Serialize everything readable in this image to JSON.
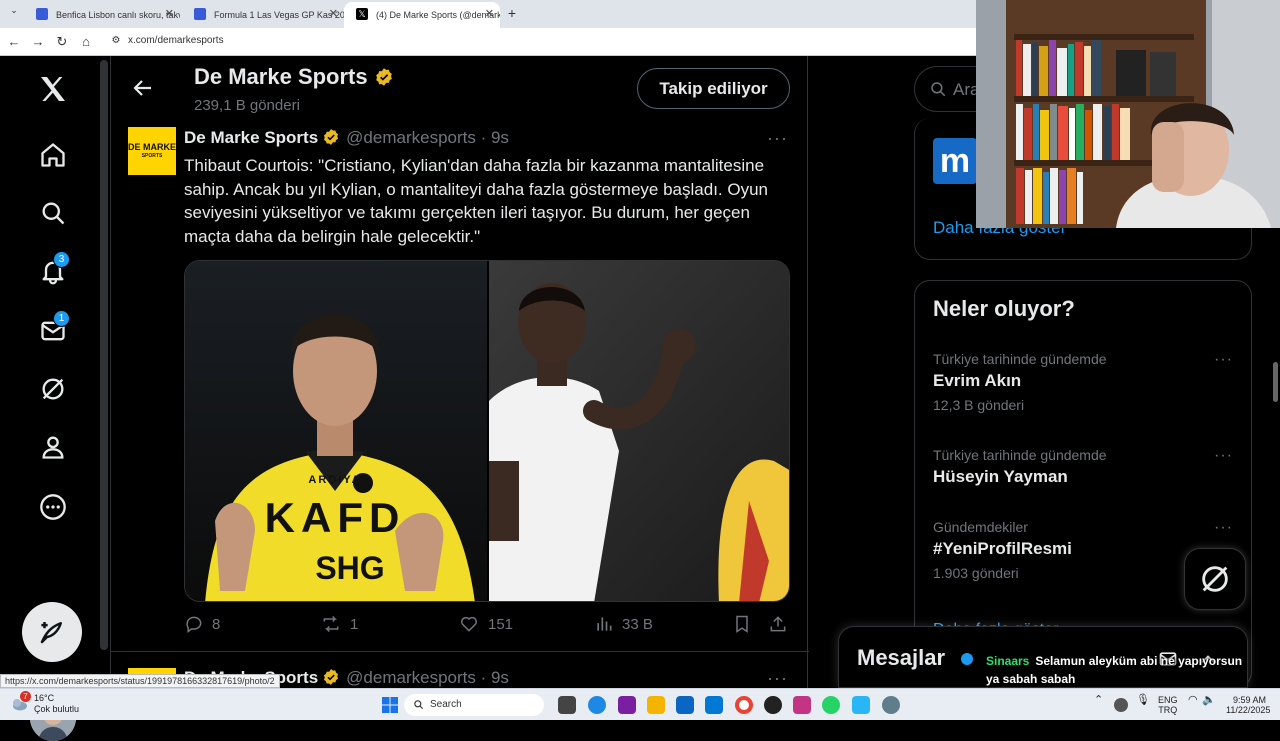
{
  "browser": {
    "tabs": [
      {
        "title": "Benfica Lisbon canlı skoru, takvi",
        "active": false
      },
      {
        "title": "Formula 1 Las Vegas GP Kas 20...",
        "active": false
      },
      {
        "title": "(4) De Marke Sports (@demark",
        "active": true
      }
    ],
    "new_tab": "+",
    "url": "x.com/demarkesports",
    "status_url": "https://x.com/demarkesports/status/1991978166332817619/photo/2"
  },
  "nav": {
    "notifications_badge": "3",
    "messages_badge": "1",
    "icons": [
      "x-logo-icon",
      "home-icon",
      "search-icon",
      "bell-icon",
      "mail-icon",
      "grok-icon",
      "profile-icon",
      "more-icon",
      "post-icon"
    ]
  },
  "header": {
    "title": "De Marke Sports",
    "posts_count": "239,1 B gönderi",
    "follow_label": "Takip ediliyor"
  },
  "tweet": {
    "avatar_text_1": "DE MARKE",
    "avatar_text_2": "SPORTS",
    "name": "De Marke Sports",
    "handle_time": "@demarkesports · 9s",
    "more": "···",
    "text": "Thibaut Courtois: \"Cristiano, Kylian'dan daha fazla bir kazanma mantalitesine sahip. Ancak bu yıl Kylian, o mantaliteyi daha fazla göstermeye başladı. Oyun seviyesini yükseltiyor ve takımı gerçekten ileri taşıyor. Bu durum, her geçen maçta daha da belirgin hale gelecektir.\"",
    "jersey_text_1": "KAFD",
    "jersey_text_2": "SHG",
    "jersey_text_3": "ARDIYA",
    "replies": "8",
    "reposts": "1",
    "likes": "151",
    "views": "33 B"
  },
  "tweet2": {
    "name": "De Marke Sports",
    "handle_time": "@demarkesports · 9s",
    "more": "···"
  },
  "right": {
    "search_placeholder": "Ara",
    "card_logo": "m",
    "show_more": "Daha fazla göster",
    "trends_title": "Neler oluyor?",
    "trends": [
      {
        "context": "Türkiye tarihinde gündemde",
        "name": "Evrim Akın",
        "count": "12,3 B gönderi"
      },
      {
        "context": "Türkiye tarihinde gündemde",
        "name": "Hüseyin Yayman",
        "count": ""
      },
      {
        "context": "Gündemdekiler",
        "name": "#YeniProfilResmi",
        "count": "1.903 gönderi"
      }
    ],
    "trends_more": "···",
    "show_more_2": "Daha fazla göster",
    "messages_title": "Mesajlar"
  },
  "chat": {
    "user": "Sinaars",
    "message": "Selamun aleyküm abi ne yapıyorsun ya sabah sabah"
  },
  "taskbar": {
    "temp": "16°C",
    "weather": "Çok bulutlu",
    "weather_badge": "7",
    "search": "Search",
    "lang_1": "ENG",
    "lang_2": "TRQ",
    "time": "9:59 AM",
    "date": "11/22/2025"
  }
}
